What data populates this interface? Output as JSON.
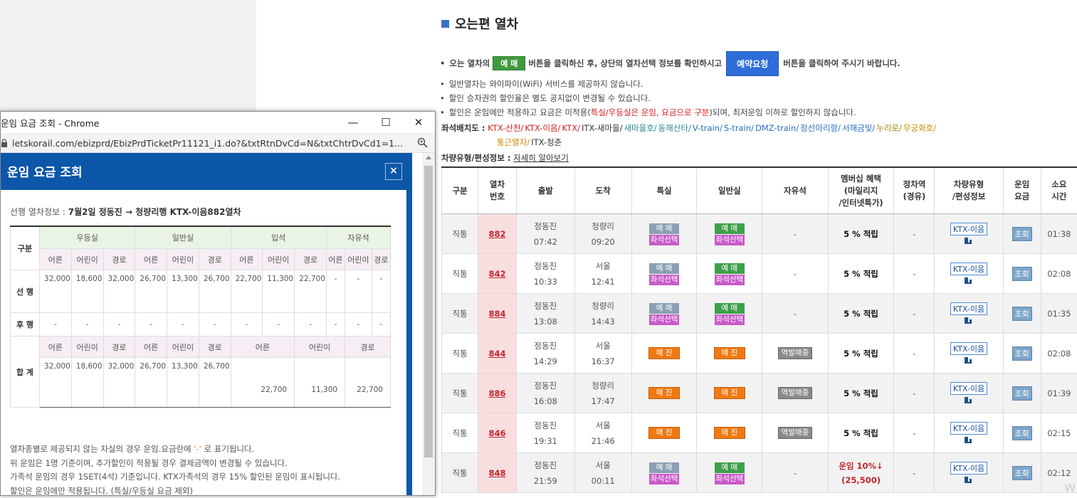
{
  "main": {
    "section_title": "오는편 열차",
    "notes": {
      "n1_pre": "오는 열차의",
      "n1_btn": "예 매",
      "n1_mid": "버튼을 클릭하신 후, 상단의 열차선택 정보를 확인하시고",
      "n1_req": "예약요청",
      "n1_post": "버튼을 클릭하여 주시기 바랍니다.",
      "n2": "일반열차는 와이파이(WiFi) 서비스를 제공하지 않습니다.",
      "n3": "할인 승차권의 할인율은 별도 공지없이 변경될 수 있습니다.",
      "n4_pre": "할인은 운임에만 적용하고 요금은 미적용(",
      "n4_red": "특실/우등실은 운임, 요금으로 구분",
      "n4_post": ")되며, 최저운임 이하로 할인하지 않습니다."
    },
    "legend": {
      "label": "좌석배치도 :",
      "items": [
        {
          "t": "KTX-산천/",
          "c": "#d32020"
        },
        {
          "t": "KTX-이음/",
          "c": "#d32020"
        },
        {
          "t": "KTX/",
          "c": "#d32020"
        },
        {
          "t": "ITX-새마을/",
          "c": "#333333"
        },
        {
          "t": "새마을호/",
          "c": "#2a8a8a"
        },
        {
          "t": "동해산타/",
          "c": "#2a8a8a"
        },
        {
          "t": "V-train/",
          "c": "#2a6fc0"
        },
        {
          "t": "S-train/",
          "c": "#2a6fc0"
        },
        {
          "t": "DMZ-train/",
          "c": "#2a6fc0"
        },
        {
          "t": "정선아리랑/",
          "c": "#2a6fc0"
        },
        {
          "t": "서해금빛/",
          "c": "#2a6fc0"
        },
        {
          "t": "누리로/",
          "c": "#9a8a00"
        },
        {
          "t": "무궁화호/",
          "c": "#d08a00"
        }
      ],
      "items2": [
        {
          "t": "통근열차/",
          "c": "#d08a00"
        },
        {
          "t": "ITX-청춘",
          "c": "#333333"
        }
      ]
    },
    "vehicle_info_label": "차량유형/편성정보 :",
    "vehicle_info_link": "자세히 알아보기",
    "table": {
      "headers": [
        "구분",
        "열차\n번호",
        "출발",
        "도착",
        "특실",
        "일반실",
        "자유석",
        "멤버십 혜택\n(마일리지\n/인터넷특가)",
        "정차역\n(경유)",
        "차량유형\n/편성정보",
        "운임\n요금",
        "소요\n시간"
      ],
      "rows": [
        {
          "type": "직통",
          "no": "882",
          "dep": "정동진",
          "dep_t": "07:42",
          "arr": "청량리",
          "arr_t": "09:20",
          "sp": [
            "예 매",
            "좌석선택"
          ],
          "gen": [
            "예 매",
            "좌석선택"
          ],
          "free": "-",
          "mem": "5 % 적립",
          "via": "-",
          "veh": "KTX-이음",
          "fare": "조회",
          "dur": "01:38"
        },
        {
          "type": "직통",
          "no": "842",
          "dep": "정동진",
          "dep_t": "10:33",
          "arr": "서울",
          "arr_t": "12:41",
          "sp": [
            "예 매",
            "좌석선택"
          ],
          "gen": [
            "예 매",
            "좌석선택"
          ],
          "free": "-",
          "mem": "5 % 적립",
          "via": "-",
          "veh": "KTX-이음",
          "fare": "조회",
          "dur": "02:08"
        },
        {
          "type": "직통",
          "no": "884",
          "dep": "정동진",
          "dep_t": "13:08",
          "arr": "청량리",
          "arr_t": "14:43",
          "sp": [
            "예 매",
            "좌석선택"
          ],
          "gen": [
            "예 매",
            "좌석선택"
          ],
          "free": "-",
          "mem": "5 % 적립",
          "via": "-",
          "veh": "KTX-이음",
          "fare": "조회",
          "dur": "01:35"
        },
        {
          "type": "직통",
          "no": "844",
          "dep": "정동진",
          "dep_t": "14:29",
          "arr": "서울",
          "arr_t": "16:37",
          "sp": [
            "매 진"
          ],
          "gen": [
            "매 진"
          ],
          "free": "역발매중",
          "mem": "5 % 적립",
          "via": "-",
          "veh": "KTX-이음",
          "fare": "조회",
          "dur": "02:08"
        },
        {
          "type": "직통",
          "no": "886",
          "dep": "정동진",
          "dep_t": "16:08",
          "arr": "청량리",
          "arr_t": "17:47",
          "sp": [
            "매 진"
          ],
          "gen": [
            "매 진"
          ],
          "free": "역발매중",
          "mem": "5 % 적립",
          "via": "-",
          "veh": "KTX-이음",
          "fare": "조회",
          "dur": "01:39"
        },
        {
          "type": "직통",
          "no": "846",
          "dep": "정동진",
          "dep_t": "19:31",
          "arr": "서울",
          "arr_t": "21:46",
          "sp": [
            "매 진"
          ],
          "gen": [
            "매 진"
          ],
          "free": "역발매중",
          "mem": "5 % 적립",
          "via": "-",
          "veh": "KTX-이음",
          "fare": "조회",
          "dur": "02:15"
        },
        {
          "type": "직통",
          "no": "848",
          "dep": "정동진",
          "dep_t": "21:59",
          "arr": "서울",
          "arr_t": "00:11",
          "sp": [
            "예 매",
            "좌석선택"
          ],
          "gen": [
            "예 매",
            "좌석선택"
          ],
          "free": "-",
          "mem": "운임 10%↓",
          "mem2": "(25,500)",
          "via": "-",
          "veh": "KTX-이음",
          "fare": "조회",
          "dur": "02:12"
        }
      ]
    },
    "watermark": "W"
  },
  "popup": {
    "window_title": "운임 요금 조회 - Chrome",
    "url": "letskorail.com/ebizprd/EbizPrdTicketPr11121_i1.do?&txtRtnDvCd=N&txtChtrDvCd1=1...",
    "modal_title": "운임 요금 조회",
    "close": "×",
    "prev_label": "선행 열차정보 :",
    "prev_value": "7월2일 정동진   →   청량리행 KTX-이음882열차",
    "fare_table": {
      "col_label": "구분",
      "groups": [
        "우등실",
        "일반실",
        "입석",
        "자유석"
      ],
      "subs": [
        "어른",
        "어린이",
        "경로"
      ],
      "rows": [
        {
          "label": "선 행",
          "vals": [
            "32,000",
            "18,600",
            "32,000",
            "26,700",
            "13,300",
            "26,700",
            "22,700",
            "11,300",
            "22,700",
            "-",
            "-",
            "-"
          ]
        },
        {
          "label": "후 행",
          "vals": [
            "-",
            "-",
            "-",
            "-",
            "-",
            "-",
            "-",
            "-",
            "-",
            "-",
            "-",
            "-"
          ]
        }
      ],
      "total_label": "합 계",
      "total_subs2": [
        "어른",
        "어린이",
        "경로"
      ],
      "total_vals": [
        "32,000",
        "18,600",
        "32,000",
        "26,700",
        "13,300",
        "26,700"
      ],
      "total_vals2": [
        "22,700",
        "11,300",
        "22,700"
      ]
    },
    "foot": {
      "f1_pre": "열차종별로 제공되지 않는 차실의 경우 운임.요금란에 ",
      "f1_mark": "'-'",
      "f1_post": " 로 표기됩니다.",
      "f2": "위 운임은 1명 기준이며, 추가할인이 적용될 경우 결제금액이 변경될 수 있습니다.",
      "f3": "가족석 운임의 경우 1SET(4석) 기준입니다. KTX가족석의 경우 15% 할인된 운임이 표시됩니다.",
      "f4": "할인은 운임에만 적용됩니다. (특실/우등실 요금 제외)"
    }
  }
}
